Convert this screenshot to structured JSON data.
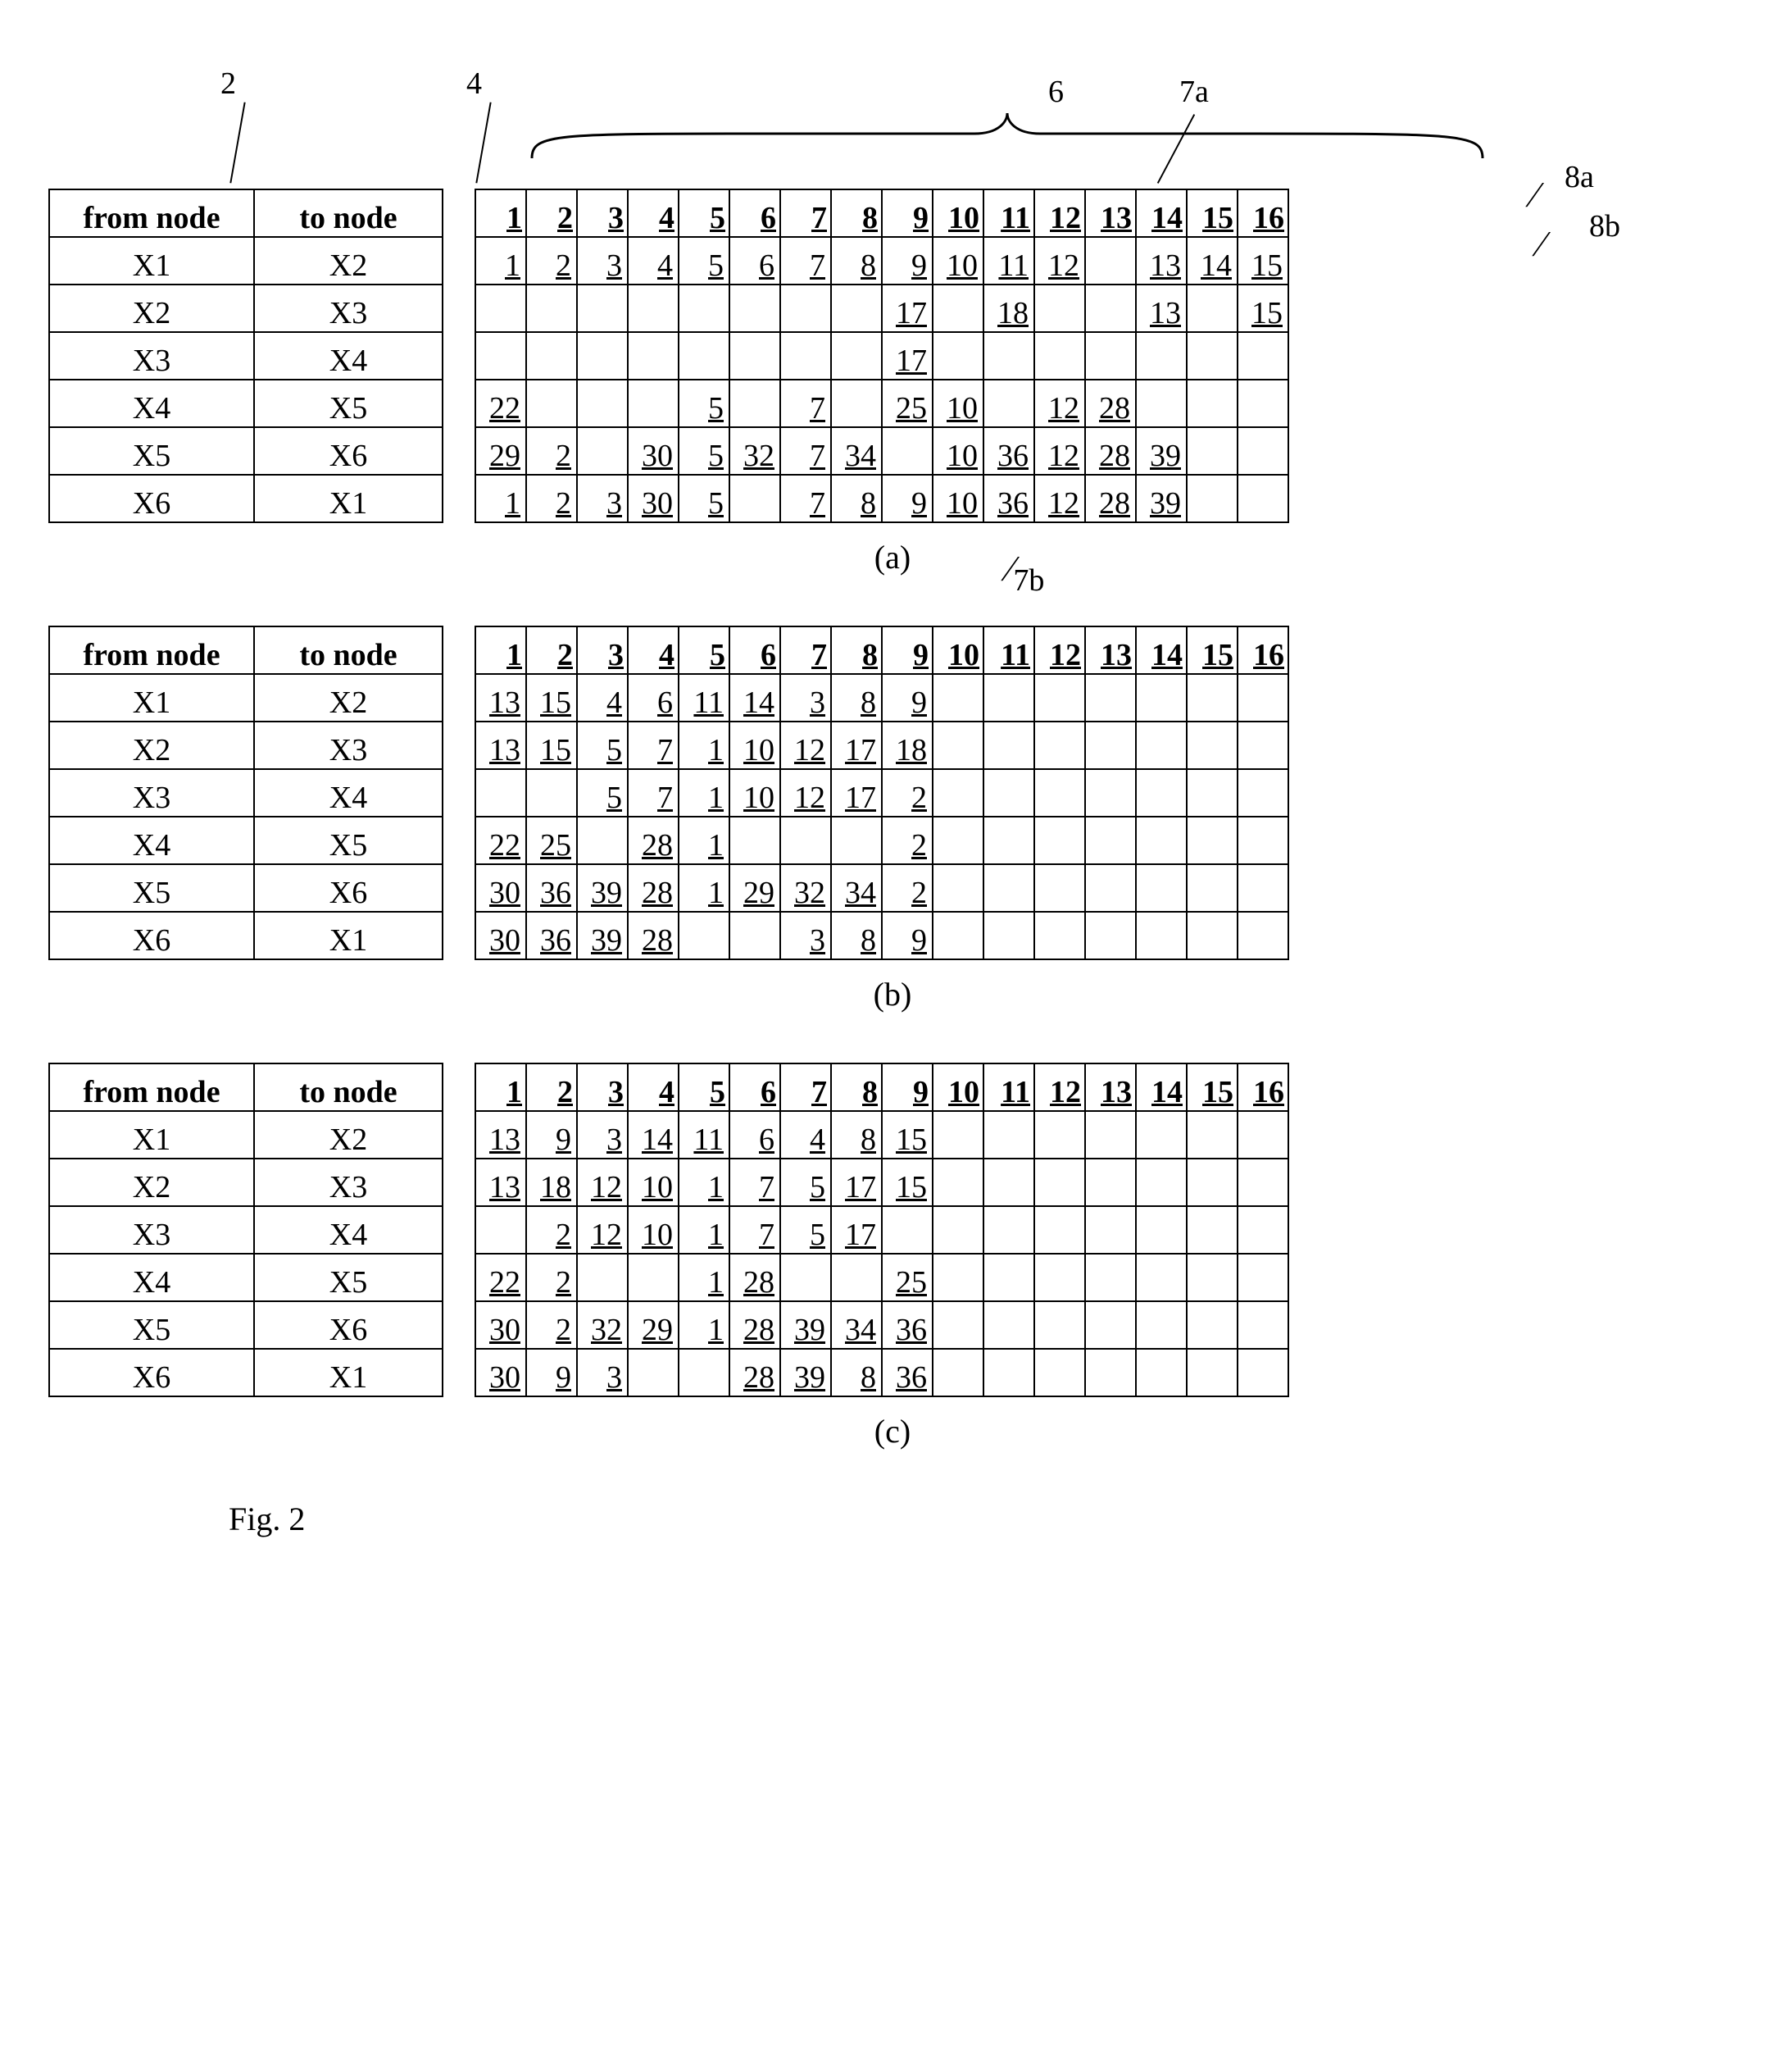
{
  "chart_data": [
    {
      "type": "table",
      "label": "(a)",
      "columns": [
        "from node",
        "to node",
        "1",
        "2",
        "3",
        "4",
        "5",
        "6",
        "7",
        "8",
        "9",
        "10",
        "11",
        "12",
        "13",
        "14",
        "15",
        "16"
      ],
      "rows": [
        {
          "from": "X1",
          "to": "X2",
          "cells": [
            "1",
            "2",
            "3",
            "4",
            "5",
            "6",
            "7",
            "8",
            "9",
            "10",
            "11",
            "12",
            "",
            "13",
            "14",
            "15"
          ]
        },
        {
          "from": "X2",
          "to": "X3",
          "cells": [
            "",
            "",
            "",
            "",
            "",
            "",
            "",
            "",
            "17",
            "",
            "18",
            "",
            "",
            "13",
            "",
            "15"
          ]
        },
        {
          "from": "X3",
          "to": "X4",
          "cells": [
            "",
            "",
            "",
            "",
            "",
            "",
            "",
            "",
            "17",
            "",
            "",
            "",
            "",
            "",
            "",
            ""
          ]
        },
        {
          "from": "X4",
          "to": "X5",
          "cells": [
            "22",
            "",
            "",
            "",
            "5",
            "",
            "7",
            "",
            "25",
            "10",
            "",
            "12",
            "28",
            "",
            "",
            ""
          ]
        },
        {
          "from": "X5",
          "to": "X6",
          "cells": [
            "29",
            "2",
            "",
            "30",
            "5",
            "32",
            "7",
            "34",
            "",
            "10",
            "36",
            "12",
            "28",
            "39",
            "",
            ""
          ]
        },
        {
          "from": "X6",
          "to": "X1",
          "cells": [
            "1",
            "2",
            "3",
            "30",
            "5",
            "",
            "7",
            "8",
            "9",
            "10",
            "36",
            "12",
            "28",
            "39",
            "",
            ""
          ]
        }
      ],
      "annotations": {
        "col_from": "2",
        "col_to": "4",
        "brace": "6",
        "ptr_7a": "7a",
        "ptr_7b": "7b",
        "ptr_8a": "8a",
        "ptr_8b": "8b"
      }
    },
    {
      "type": "table",
      "label": "(b)",
      "columns": [
        "from node",
        "to node",
        "1",
        "2",
        "3",
        "4",
        "5",
        "6",
        "7",
        "8",
        "9",
        "10",
        "11",
        "12",
        "13",
        "14",
        "15",
        "16"
      ],
      "rows": [
        {
          "from": "X1",
          "to": "X2",
          "cells": [
            "13",
            "15",
            "4",
            "6",
            "11",
            "14",
            "3",
            "8",
            "9",
            "",
            "",
            "",
            "",
            "",
            "",
            ""
          ]
        },
        {
          "from": "X2",
          "to": "X3",
          "cells": [
            "13",
            "15",
            "5",
            "7",
            "1",
            "10",
            "12",
            "17",
            "18",
            "",
            "",
            "",
            "",
            "",
            "",
            ""
          ]
        },
        {
          "from": "X3",
          "to": "X4",
          "cells": [
            "",
            "",
            "5",
            "7",
            "1",
            "10",
            "12",
            "17",
            "2",
            "",
            "",
            "",
            "",
            "",
            "",
            ""
          ]
        },
        {
          "from": "X4",
          "to": "X5",
          "cells": [
            "22",
            "25",
            "",
            "28",
            "1",
            "",
            "",
            "",
            "2",
            "",
            "",
            "",
            "",
            "",
            "",
            ""
          ]
        },
        {
          "from": "X5",
          "to": "X6",
          "cells": [
            "30",
            "36",
            "39",
            "28",
            "1",
            "29",
            "32",
            "34",
            "2",
            "",
            "",
            "",
            "",
            "",
            "",
            ""
          ]
        },
        {
          "from": "X6",
          "to": "X1",
          "cells": [
            "30",
            "36",
            "39",
            "28",
            "",
            "",
            "3",
            "8",
            "9",
            "",
            "",
            "",
            "",
            "",
            "",
            ""
          ]
        }
      ]
    },
    {
      "type": "table",
      "label": "(c)",
      "columns": [
        "from node",
        "to node",
        "1",
        "2",
        "3",
        "4",
        "5",
        "6",
        "7",
        "8",
        "9",
        "10",
        "11",
        "12",
        "13",
        "14",
        "15",
        "16"
      ],
      "rows": [
        {
          "from": "X1",
          "to": "X2",
          "cells": [
            "13",
            "9",
            "3",
            "14",
            "11",
            "6",
            "4",
            "8",
            "15",
            "",
            "",
            "",
            "",
            "",
            "",
            ""
          ]
        },
        {
          "from": "X2",
          "to": "X3",
          "cells": [
            "13",
            "18",
            "12",
            "10",
            "1",
            "7",
            "5",
            "17",
            "15",
            "",
            "",
            "",
            "",
            "",
            "",
            ""
          ]
        },
        {
          "from": "X3",
          "to": "X4",
          "cells": [
            "",
            "2",
            "12",
            "10",
            "1",
            "7",
            "5",
            "17",
            "",
            "",
            "",
            "",
            "",
            "",
            "",
            ""
          ]
        },
        {
          "from": "X4",
          "to": "X5",
          "cells": [
            "22",
            "2",
            "",
            "",
            "1",
            "28",
            "",
            "",
            "25",
            "",
            "",
            "",
            "",
            "",
            "",
            ""
          ]
        },
        {
          "from": "X5",
          "to": "X6",
          "cells": [
            "30",
            "2",
            "32",
            "29",
            "1",
            "28",
            "39",
            "34",
            "36",
            "",
            "",
            "",
            "",
            "",
            "",
            ""
          ]
        },
        {
          "from": "X6",
          "to": "X1",
          "cells": [
            "30",
            "9",
            "3",
            "",
            "",
            "28",
            "39",
            "8",
            "36",
            "",
            "",
            "",
            "",
            "",
            "",
            ""
          ]
        }
      ]
    }
  ],
  "figure_caption": "Fig. 2",
  "headers": {
    "from": "from node",
    "to": "to node"
  }
}
